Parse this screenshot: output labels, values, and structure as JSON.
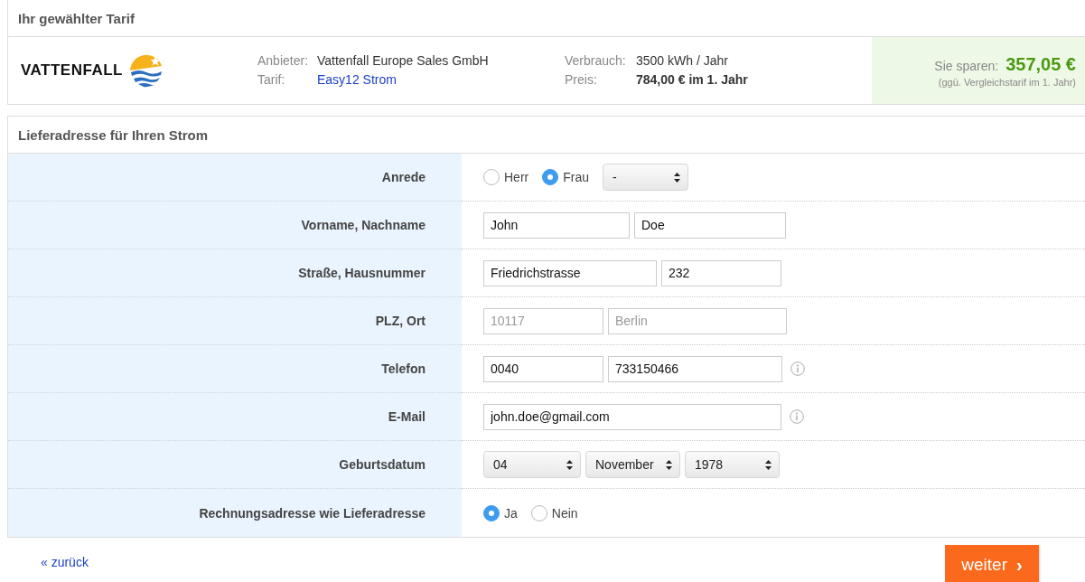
{
  "tariff_section": {
    "title": "Ihr gewählter Tarif",
    "logo_text": "VATTENFALL",
    "details": [
      {
        "label": "Anbieter:",
        "value": "Vattenfall Europe Sales GmbH",
        "kind": "plain"
      },
      {
        "label": "Tarif:",
        "value": "Easy12 Strom",
        "kind": "link"
      },
      {
        "label": "Verbrauch:",
        "value": "3500 kWh / Jahr",
        "kind": "plain"
      },
      {
        "label": "Preis:",
        "value": "784,00 € im 1. Jahr",
        "kind": "bold"
      }
    ],
    "savings": {
      "label": "Sie sparen:",
      "amount": "357,05 €",
      "note": "(ggü. Vergleichstarif im 1. Jahr)"
    }
  },
  "address_section": {
    "title": "Lieferadresse für Ihren Strom",
    "rows": [
      {
        "label": "Anrede",
        "info": false,
        "controls": [
          {
            "kind": "radio",
            "label": "Herr",
            "selected": false
          },
          {
            "kind": "radio",
            "label": "Frau",
            "selected": true
          },
          {
            "kind": "select",
            "value": "-"
          }
        ]
      },
      {
        "label": "Vorname, Nachname",
        "info": false,
        "controls": [
          {
            "kind": "text",
            "value": "John",
            "disabled": false
          },
          {
            "kind": "text",
            "value": "Doe",
            "disabled": false
          }
        ]
      },
      {
        "label": "Straße, Hausnummer",
        "info": false,
        "controls": [
          {
            "kind": "text",
            "value": "Friedrichstrasse",
            "disabled": false
          },
          {
            "kind": "text",
            "value": "232",
            "disabled": false
          }
        ]
      },
      {
        "label": "PLZ, Ort",
        "info": false,
        "controls": [
          {
            "kind": "text",
            "value": "10117",
            "disabled": true
          },
          {
            "kind": "text",
            "value": "Berlin",
            "disabled": true
          }
        ]
      },
      {
        "label": "Telefon",
        "info": true,
        "controls": [
          {
            "kind": "text",
            "value": "0040",
            "disabled": false
          },
          {
            "kind": "text",
            "value": "733150466",
            "disabled": false
          }
        ]
      },
      {
        "label": "E-Mail",
        "info": true,
        "controls": [
          {
            "kind": "text",
            "value": "john.doe@gmail.com",
            "disabled": false
          }
        ]
      },
      {
        "label": "Geburtsdatum",
        "info": false,
        "controls": [
          {
            "kind": "select",
            "value": "04"
          },
          {
            "kind": "select",
            "value": "November"
          },
          {
            "kind": "select",
            "value": "1978"
          }
        ]
      },
      {
        "label": "Rechnungsadresse wie Lieferadresse",
        "info": false,
        "controls": [
          {
            "kind": "radio",
            "label": "Ja",
            "selected": true
          },
          {
            "kind": "radio",
            "label": "Nein",
            "selected": false
          }
        ]
      }
    ]
  },
  "footer": {
    "back_link": "« zurück",
    "next_button": "weiter",
    "next_icon": "›"
  }
}
